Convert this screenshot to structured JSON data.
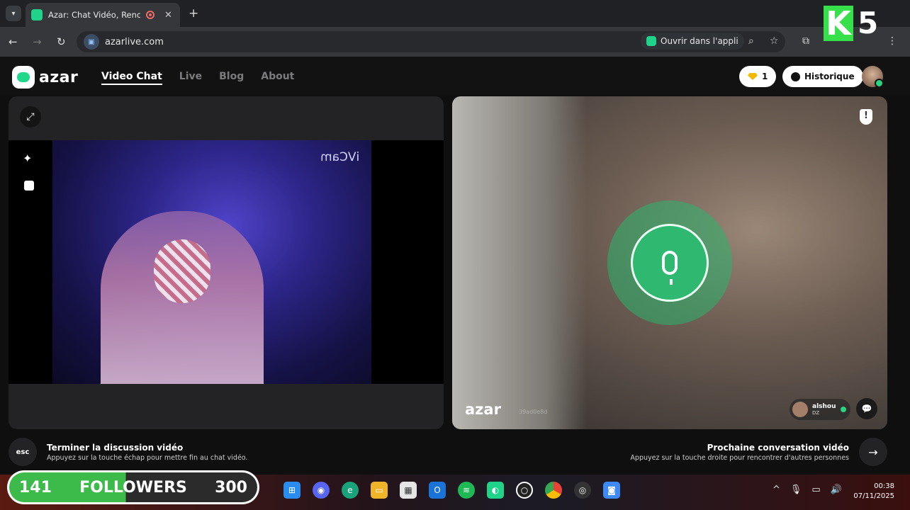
{
  "browser": {
    "tab_title": "Azar: Chat Vidéo, Rencontre",
    "tab_close": "✕",
    "new_tab": "+",
    "url": "azarlive.com",
    "open_in_app": "Ouvrir dans l'appli"
  },
  "overlay_logo": {
    "k": "K",
    "five": "5"
  },
  "app": {
    "logo_text": "azar",
    "nav": [
      "Video Chat",
      "Live",
      "Blog",
      "About"
    ],
    "active_nav": "Video Chat",
    "gems": "1",
    "history": "Historique"
  },
  "left_panel": {
    "watermark": "iVCam"
  },
  "right_panel": {
    "logo_text": "azar",
    "session_id": "39ad0e8d",
    "peer_name": "alshou",
    "peer_country": "DZ"
  },
  "controls": {
    "esc_label": "esc",
    "end_title": "Terminer la discussion vidéo",
    "end_sub": "Appuyez sur la touche échap pour mettre fin au chat vidéo.",
    "next_title": "Prochaine conversation vidéo",
    "next_sub": "Appuyez sur la touche droite pour rencontrer d'autres personnes"
  },
  "followers": {
    "current": "141",
    "label": "FOLLOWERS",
    "goal": "300",
    "progress": 0.47
  },
  "taskbar": {
    "time": "00:38",
    "date": "07/11/2025"
  }
}
